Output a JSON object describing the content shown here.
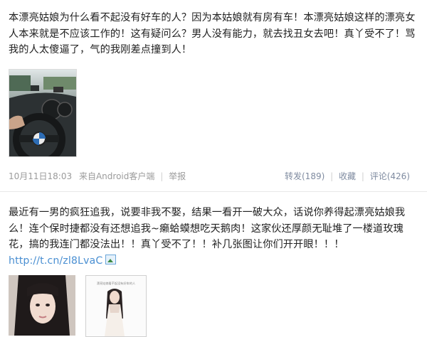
{
  "post1": {
    "text": "本漂亮姑娘为什么看不起没有好车的人？因为本姑娘就有房有车！本漂亮姑娘这样的漂亮女人本来就是不应该工作的！这有疑问么？男人没有能力，就去找丑女去吧！真丫受不了！骂我的人太傻逼了，气的我刚差点撞到人！",
    "time": "10月11日18:03",
    "source_prefix": "来自",
    "source": "Android客户端",
    "report": "举报",
    "repost": "转发(189)",
    "favorite": "收藏",
    "comment": "评论(426)"
  },
  "post2": {
    "text": "最近有一男的疯狂追我，说要非我不娶，结果一看开一破大众，话说你养得起漂亮姑娘我么！连个保时捷都没有还想追我~癞蛤蟆想吃天鹅肉！这家伙还厚颜无耻堆了一楼道玫瑰花，搞的我连门都没法出！！真丫受不了！！补几张图让你们开开眼！！！",
    "link": "http://t.cn/zl8LvaC"
  },
  "thumb2_caption": "漂亮姑娘看不起没有好车的人"
}
